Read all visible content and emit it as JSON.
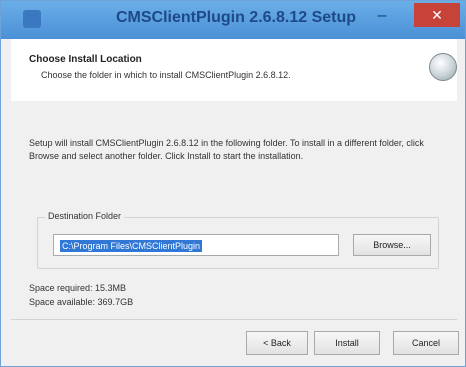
{
  "window": {
    "title": "CMSClientPlugin 2.6.8.12 Setup",
    "minimize_glyph": "–",
    "close_glyph": "✕"
  },
  "header": {
    "title": "Choose Install Location",
    "subtitle": "Choose the folder in which to install CMSClientPlugin 2.6.8.12."
  },
  "body": {
    "description": "Setup will install CMSClientPlugin 2.6.8.12 in the following folder. To install in a different folder, click Browse and select another folder. Click Install to start the installation.",
    "destination_label": "Destination Folder",
    "destination_value": "C:\\Program Files\\CMSClientPlugin",
    "browse_label": "Browse...",
    "space_required": "Space required: 15.3MB",
    "space_available": "Space available: 369.7GB"
  },
  "buttons": {
    "back": "< Back",
    "install": "Install",
    "cancel": "Cancel"
  },
  "colors": {
    "titlebar": "#4b90d6",
    "close": "#c7433a",
    "selection": "#3178d6"
  }
}
